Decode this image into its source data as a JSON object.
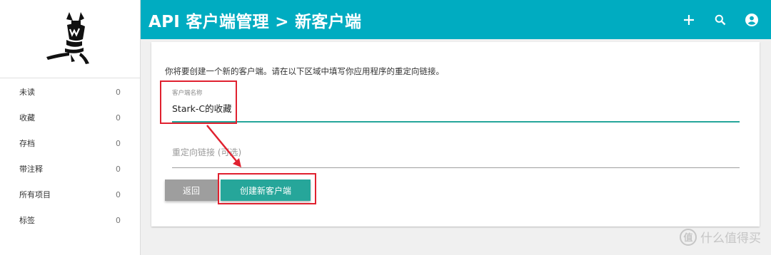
{
  "header": {
    "title": "API 客户端管理 > 新客户端",
    "add_icon": "plus-icon",
    "search_icon": "search-icon",
    "account_icon": "account-circle-icon",
    "color": "#00acc1"
  },
  "sidebar": {
    "logo_icon": "wallabag-logo-icon",
    "items": [
      {
        "label": "未读",
        "count": "0"
      },
      {
        "label": "收藏",
        "count": "0"
      },
      {
        "label": "存档",
        "count": "0"
      },
      {
        "label": "带注释",
        "count": "0"
      },
      {
        "label": "所有项目",
        "count": "0"
      },
      {
        "label": "标签",
        "count": "0"
      }
    ]
  },
  "form": {
    "intro": "你将要创建一个新的客户端。请在以下区域中填写你应用程序的重定向链接。",
    "client_name_label": "客户端名称",
    "client_name_value": "Stark-C的收藏",
    "redirect_placeholder": "重定向链接 (可选)",
    "back_label": "返回",
    "create_label": "创建新客户端",
    "accent_color": "#26a69a"
  },
  "watermark": {
    "logo_char": "值",
    "text": "什么值得买"
  }
}
